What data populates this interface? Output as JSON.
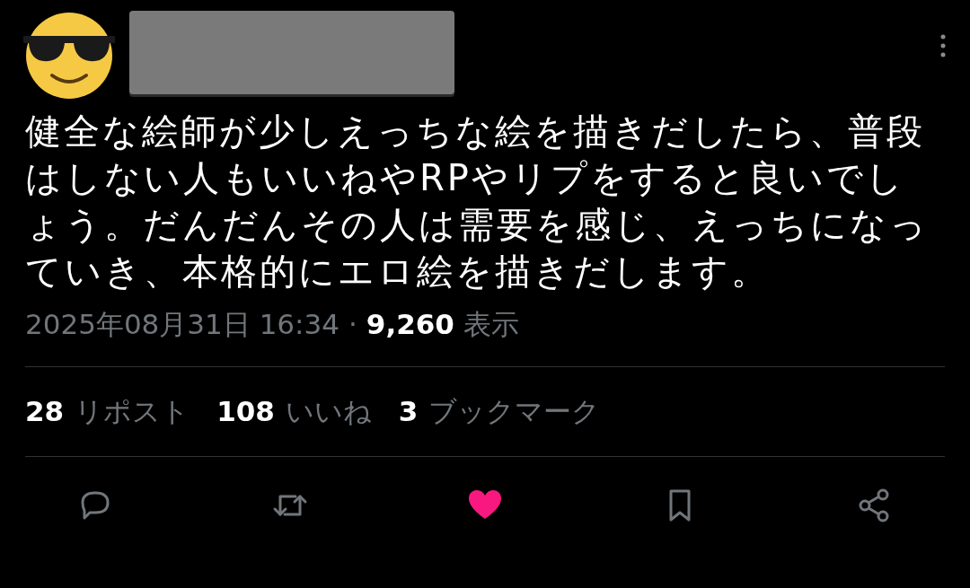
{
  "tweet": {
    "text": "健全な絵師が少しえっちな絵を描きだしたら、普段はしない人もいいねやRPやリプをすると良いでしょう。だんだんその人は需要を感じ、えっちになっていき、本格的にエロ絵を描きだします。",
    "timestamp": "2025年08月31日 16:34",
    "separator": "·",
    "views": "9,260",
    "views_label": "表示"
  },
  "stats": [
    {
      "count": "28",
      "label": "リポスト"
    },
    {
      "count": "108",
      "label": "いいね"
    },
    {
      "count": "3",
      "label": "ブックマーク"
    }
  ],
  "actions": [
    {
      "kind": "reply"
    },
    {
      "kind": "repost"
    },
    {
      "kind": "like",
      "liked": true
    },
    {
      "kind": "bookmark"
    },
    {
      "kind": "share"
    }
  ]
}
